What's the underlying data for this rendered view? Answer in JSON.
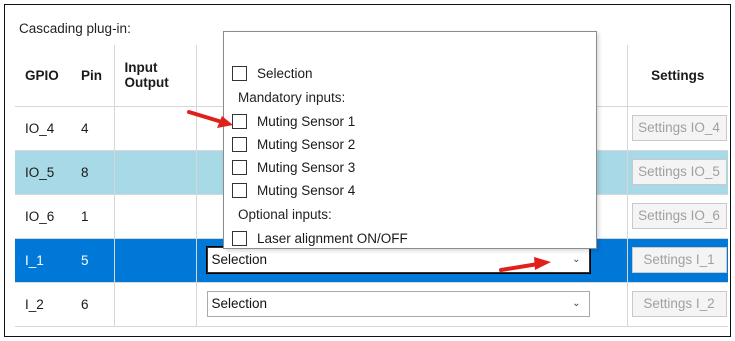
{
  "panel": {
    "title": "Cascading plug-in:"
  },
  "table": {
    "headers": {
      "gpio": "GPIO",
      "pin": "Pin",
      "io_line1": "Input",
      "io_line2": "Output",
      "settings": "Settings"
    },
    "rows": [
      {
        "gpio": "IO_4",
        "pin": "4",
        "function": "",
        "settings": "Settings IO_4",
        "state": "normal"
      },
      {
        "gpio": "IO_5",
        "pin": "8",
        "function": "",
        "settings": "Settings IO_5",
        "state": "highlighted"
      },
      {
        "gpio": "IO_6",
        "pin": "1",
        "function": "",
        "settings": "Settings IO_6",
        "state": "normal"
      },
      {
        "gpio": "I_1",
        "pin": "5",
        "function": "Selection",
        "settings": "Settings I_1",
        "state": "selected"
      },
      {
        "gpio": "I_2",
        "pin": "6",
        "function": "Selection",
        "settings": "Settings I_2",
        "state": "normal"
      }
    ]
  },
  "dropdown": {
    "selection_label": "Selection",
    "group_mandatory": "Mandatory inputs:",
    "mandatory": [
      "Muting Sensor 1",
      "Muting Sensor 2",
      "Muting Sensor 3",
      "Muting Sensor 4"
    ],
    "group_optional": "Optional inputs:",
    "optional": [
      "Laser alignment ON/OFF"
    ]
  },
  "colors": {
    "highlight_row": "#a8d9e6",
    "selected_row": "#0078d7",
    "annotation_arrow": "#e0201b"
  },
  "icons": {
    "dropdown": "chevron-down-icon",
    "annotation": "red-arrow-icon"
  }
}
